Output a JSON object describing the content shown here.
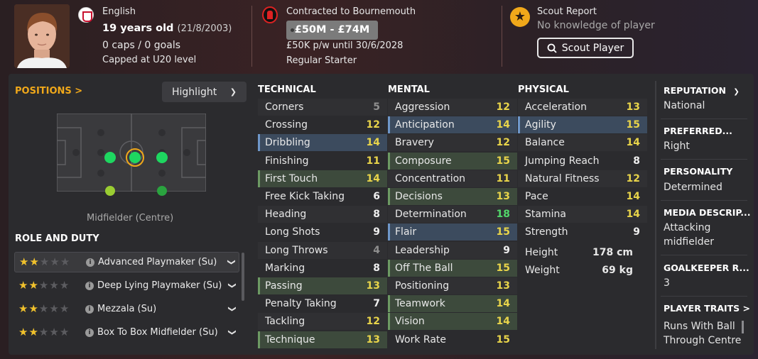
{
  "player": {
    "nationality": "English",
    "age_text": "19 years old",
    "dob": "(21/8/2003)",
    "caps_goals": "0 caps / 0 goals",
    "capped_level": "Capped at U20 level"
  },
  "contract": {
    "club_text": "Contracted to Bournemouth",
    "value_range": "£50M - £74M",
    "wage_text": "£50K p/w until 30/6/2028",
    "squad_status": "Regular Starter"
  },
  "scout": {
    "title": "Scout Report",
    "subtitle": "No knowledge of player",
    "button_label": "Scout Player",
    "icon": "star-icon"
  },
  "positions": {
    "title": "POSITIONS >",
    "highlight_label": "Highlight",
    "position_label": "Midfielder (Centre)"
  },
  "roles": {
    "title": "ROLE AND DUTY",
    "items": [
      {
        "name": "Advanced Playmaker (Su)",
        "stars": 2
      },
      {
        "name": "Deep Lying Playmaker (Su)",
        "stars": 2
      },
      {
        "name": "Mezzala (Su)",
        "stars": 2
      },
      {
        "name": "Box To Box Midfielder (Su)",
        "stars": 2
      }
    ]
  },
  "technical": {
    "title": "TECHNICAL",
    "items": [
      {
        "name": "Corners",
        "value": "5"
      },
      {
        "name": "Crossing",
        "value": "12"
      },
      {
        "name": "Dribbling",
        "value": "14"
      },
      {
        "name": "Finishing",
        "value": "11"
      },
      {
        "name": "First Touch",
        "value": "14"
      },
      {
        "name": "Free Kick Taking",
        "value": "6"
      },
      {
        "name": "Heading",
        "value": "8"
      },
      {
        "name": "Long Shots",
        "value": "9"
      },
      {
        "name": "Long Throws",
        "value": "4"
      },
      {
        "name": "Marking",
        "value": "8"
      },
      {
        "name": "Passing",
        "value": "13"
      },
      {
        "name": "Penalty Taking",
        "value": "7"
      },
      {
        "name": "Tackling",
        "value": "12"
      },
      {
        "name": "Technique",
        "value": "13"
      }
    ]
  },
  "mental": {
    "title": "MENTAL",
    "items": [
      {
        "name": "Aggression",
        "value": "12"
      },
      {
        "name": "Anticipation",
        "value": "14"
      },
      {
        "name": "Bravery",
        "value": "12"
      },
      {
        "name": "Composure",
        "value": "15"
      },
      {
        "name": "Concentration",
        "value": "11"
      },
      {
        "name": "Decisions",
        "value": "13"
      },
      {
        "name": "Determination",
        "value": "18"
      },
      {
        "name": "Flair",
        "value": "15"
      },
      {
        "name": "Leadership",
        "value": "9"
      },
      {
        "name": "Off The Ball",
        "value": "15"
      },
      {
        "name": "Positioning",
        "value": "13"
      },
      {
        "name": "Teamwork",
        "value": "14"
      },
      {
        "name": "Vision",
        "value": "14"
      },
      {
        "name": "Work Rate",
        "value": "15"
      }
    ]
  },
  "physical": {
    "title": "PHYSICAL",
    "items": [
      {
        "name": "Acceleration",
        "value": "13"
      },
      {
        "name": "Agility",
        "value": "15"
      },
      {
        "name": "Balance",
        "value": "14"
      },
      {
        "name": "Jumping Reach",
        "value": "8"
      },
      {
        "name": "Natural Fitness",
        "value": "12"
      },
      {
        "name": "Pace",
        "value": "14"
      },
      {
        "name": "Stamina",
        "value": "14"
      },
      {
        "name": "Strength",
        "value": "9"
      }
    ],
    "height_label": "Height",
    "height_value": "178 cm",
    "weight_label": "Weight",
    "weight_value": "69 kg"
  },
  "sidebar": {
    "reputation_title": "REPUTATION",
    "reputation_value": "National",
    "preferred_title": "PREFERRED...",
    "preferred_value": "Right",
    "personality_title": "PERSONALITY",
    "personality_value": "Determined",
    "media_title": "MEDIA DESCRIP...",
    "media_value_1": "Attacking",
    "media_value_2": "midfielder",
    "gk_title": "GOALKEEPER R...",
    "gk_value": "3",
    "traits_title": "PLAYER TRAITS >",
    "trait_1": "Runs With Ball",
    "trait_2": "Through Centre"
  },
  "colors": {
    "accent_orange": "#f0a81a",
    "attr_grey": "#8f8f8f",
    "attr_white": "#eeeeee",
    "attr_yellow": "#e8d44a",
    "attr_green": "#52d66a",
    "pitch_pos_natural": "#1ed760",
    "pitch_pos_accomplished": "#2aa33f",
    "pitch_pos_competent": "#9acd32"
  }
}
